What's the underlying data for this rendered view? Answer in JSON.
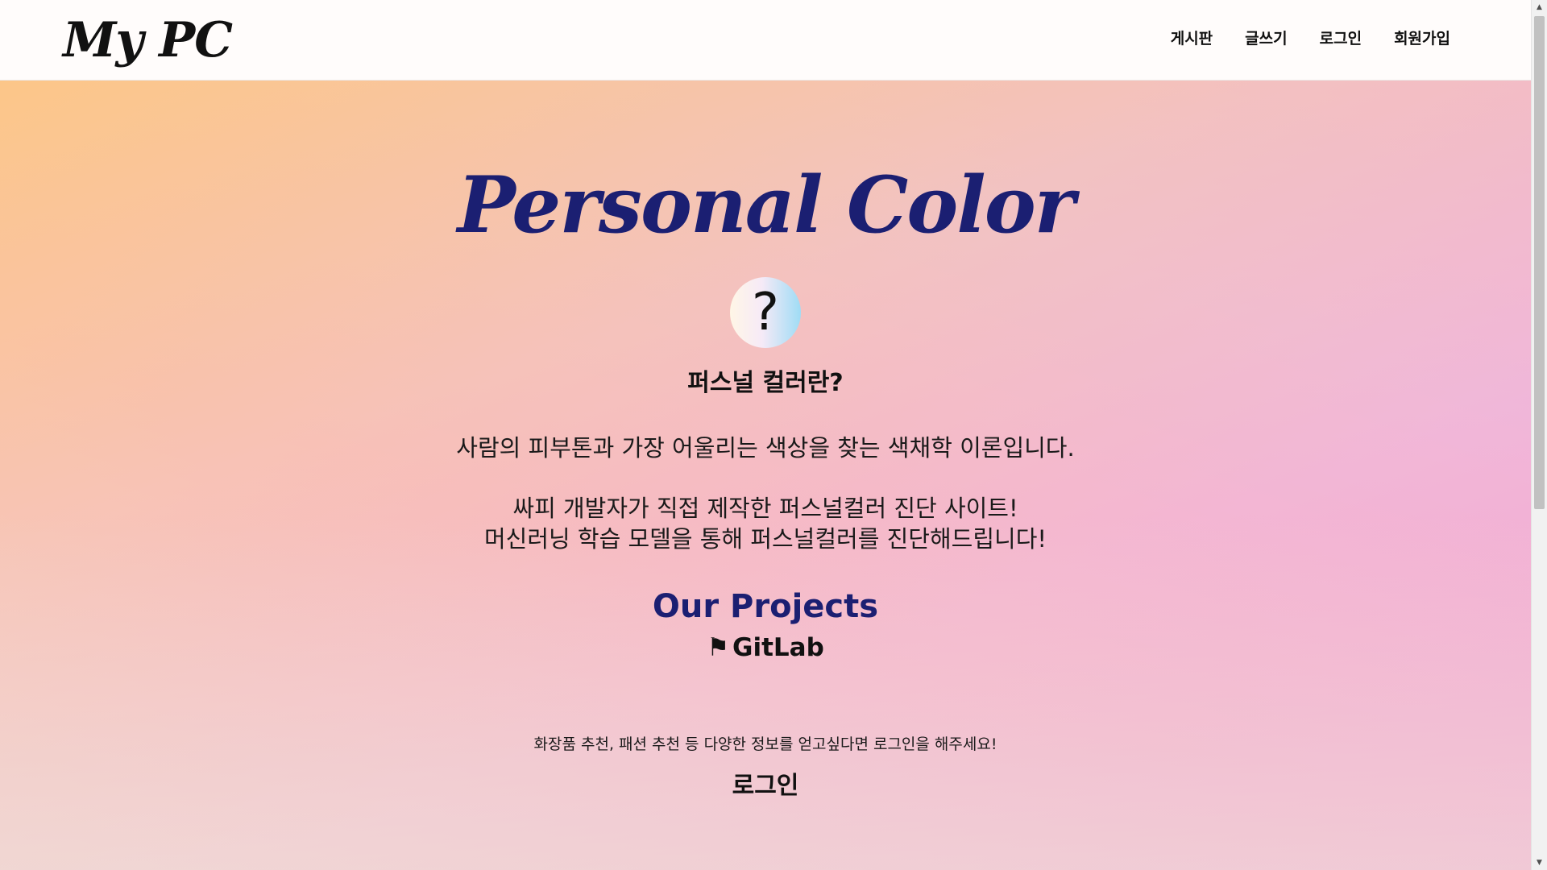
{
  "header": {
    "logo": "My PC",
    "nav": [
      "게시판",
      "글쓰기",
      "로그인",
      "회원가입"
    ]
  },
  "hero": {
    "title": "Personal Color",
    "badge_icon": "question-mark-icon",
    "badge_glyph": "?",
    "subtitle": "퍼스널 컬러란?",
    "description": "사람의 피부톤과 가장 어울리는 색상을 찾는 색채학 이론입니다.",
    "intro_line1": "싸피 개발자가 직접 제작한 퍼스널컬러 진단 사이트!",
    "intro_line2": "머신러닝 학습 모델을 통해 퍼스널컬러를 진단해드립니다!"
  },
  "projects": {
    "heading": "Our Projects",
    "flag_glyph": "⚑",
    "gitlab_label": "GitLab"
  },
  "login_prompt": {
    "notice": "화장품 추천, 패션 추천 등 다양한 정보를 얻고싶다면 로그인을 해주세요!",
    "button_label": "로그인"
  },
  "colors": {
    "title_navy": "#1b1f72",
    "text_dark": "#111111"
  }
}
